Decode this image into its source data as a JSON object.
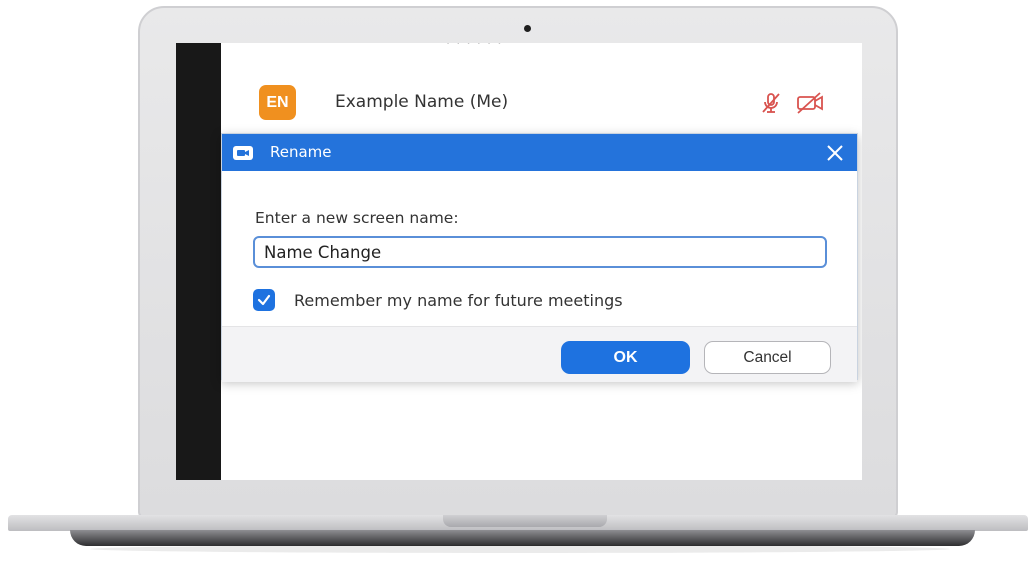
{
  "screen_header_text": "· · · · · ·",
  "participant": {
    "initials": "EN",
    "name": "Example Name (Me)",
    "mute_icon": "mic-muted-icon",
    "video_icon": "video-off-icon"
  },
  "dialog": {
    "title": "Rename",
    "prompt": "Enter a new screen name:",
    "input_value": "Name Change",
    "remember_checked": true,
    "remember_label": "Remember my name for future meetings",
    "ok_label": "OK",
    "cancel_label": "Cancel"
  },
  "colors": {
    "accent_blue": "#2473db",
    "avatar_orange": "#f0901f",
    "muted_red": "#d9534f"
  }
}
